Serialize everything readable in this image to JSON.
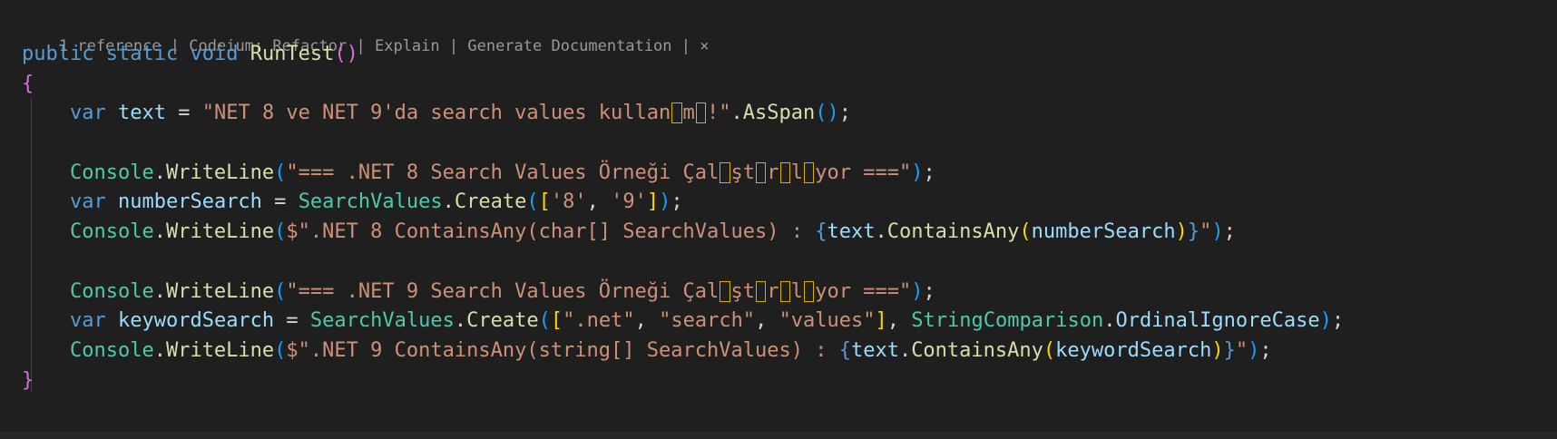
{
  "codelens": {
    "references": "1 reference",
    "codeium_refactor": "Codeium: Refactor",
    "explain": "Explain",
    "generate_docs": "Generate Documentation",
    "separator": " | ",
    "close": "×"
  },
  "lines": [
    [
      {
        "t": "public",
        "c": "kw"
      },
      {
        "t": " ",
        "c": "pu"
      },
      {
        "t": "static",
        "c": "kw"
      },
      {
        "t": " ",
        "c": "pu"
      },
      {
        "t": "void",
        "c": "kw"
      },
      {
        "t": " ",
        "c": "pu"
      },
      {
        "t": "RunTest",
        "c": "fn"
      },
      {
        "t": "()",
        "c": "pk"
      }
    ],
    [
      {
        "t": "{",
        "c": "pk"
      }
    ],
    [
      {
        "t": "    ",
        "c": "pu"
      },
      {
        "t": "var",
        "c": "kw"
      },
      {
        "t": " ",
        "c": "pu"
      },
      {
        "t": "text",
        "c": "id"
      },
      {
        "t": " = ",
        "c": "pu"
      },
      {
        "t": "\"NET 8 ve NET 9'da search values kullan",
        "c": "str"
      },
      {
        "t": "ı",
        "c": "ch"
      },
      {
        "t": "m",
        "c": "str"
      },
      {
        "t": "ı",
        "c": "ch"
      },
      {
        "t": "!\"",
        "c": "str"
      },
      {
        "t": ".",
        "c": "pu"
      },
      {
        "t": "AsSpan",
        "c": "fn"
      },
      {
        "t": "()",
        "c": "bb"
      },
      {
        "t": ";",
        "c": "pu"
      }
    ],
    [],
    [
      {
        "t": "    ",
        "c": "pu"
      },
      {
        "t": "Console",
        "c": "ty"
      },
      {
        "t": ".",
        "c": "pu"
      },
      {
        "t": "WriteLine",
        "c": "fn"
      },
      {
        "t": "(",
        "c": "bb"
      },
      {
        "t": "\"=== .NET 8 Search Values Örneği Çal",
        "c": "str"
      },
      {
        "t": "ı",
        "c": "ch"
      },
      {
        "t": "şt",
        "c": "str"
      },
      {
        "t": "ı",
        "c": "ch"
      },
      {
        "t": "r",
        "c": "str"
      },
      {
        "t": "ı",
        "c": "ch"
      },
      {
        "t": "l",
        "c": "str"
      },
      {
        "t": "ı",
        "c": "ch"
      },
      {
        "t": "yor ===\"",
        "c": "str"
      },
      {
        "t": ")",
        "c": "bb"
      },
      {
        "t": ";",
        "c": "pu"
      }
    ],
    [
      {
        "t": "    ",
        "c": "pu"
      },
      {
        "t": "var",
        "c": "kw"
      },
      {
        "t": " ",
        "c": "pu"
      },
      {
        "t": "numberSearch",
        "c": "id"
      },
      {
        "t": " = ",
        "c": "pu"
      },
      {
        "t": "SearchValues",
        "c": "ty"
      },
      {
        "t": ".",
        "c": "pu"
      },
      {
        "t": "Create",
        "c": "fn"
      },
      {
        "t": "(",
        "c": "bb"
      },
      {
        "t": "[",
        "c": "br"
      },
      {
        "t": "'8'",
        "c": "str"
      },
      {
        "t": ", ",
        "c": "pu"
      },
      {
        "t": "'9'",
        "c": "str"
      },
      {
        "t": "]",
        "c": "br"
      },
      {
        "t": ")",
        "c": "bb"
      },
      {
        "t": ";",
        "c": "pu"
      }
    ],
    [
      {
        "t": "    ",
        "c": "pu"
      },
      {
        "t": "Console",
        "c": "ty"
      },
      {
        "t": ".",
        "c": "pu"
      },
      {
        "t": "WriteLine",
        "c": "fn"
      },
      {
        "t": "(",
        "c": "bb"
      },
      {
        "t": "$\".NET 8 ContainsAny(char[] SearchValues) : ",
        "c": "str"
      },
      {
        "t": "{",
        "c": "kw"
      },
      {
        "t": "text",
        "c": "id"
      },
      {
        "t": ".",
        "c": "pu"
      },
      {
        "t": "ContainsAny",
        "c": "fn"
      },
      {
        "t": "(",
        "c": "br"
      },
      {
        "t": "numberSearch",
        "c": "id"
      },
      {
        "t": ")",
        "c": "br"
      },
      {
        "t": "}",
        "c": "kw"
      },
      {
        "t": "\"",
        "c": "str"
      },
      {
        "t": ")",
        "c": "bb"
      },
      {
        "t": ";",
        "c": "pu"
      }
    ],
    [],
    [
      {
        "t": "    ",
        "c": "pu"
      },
      {
        "t": "Console",
        "c": "ty"
      },
      {
        "t": ".",
        "c": "pu"
      },
      {
        "t": "WriteLine",
        "c": "fn"
      },
      {
        "t": "(",
        "c": "bb"
      },
      {
        "t": "\"=== .NET 9 Search Values Örneği Çal",
        "c": "str"
      },
      {
        "t": "ı",
        "c": "ch"
      },
      {
        "t": "şt",
        "c": "str"
      },
      {
        "t": "ı",
        "c": "ch"
      },
      {
        "t": "r",
        "c": "str"
      },
      {
        "t": "ı",
        "c": "ch"
      },
      {
        "t": "l",
        "c": "str"
      },
      {
        "t": "ı",
        "c": "ch"
      },
      {
        "t": "yor ===\"",
        "c": "str"
      },
      {
        "t": ")",
        "c": "bb"
      },
      {
        "t": ";",
        "c": "pu"
      }
    ],
    [
      {
        "t": "    ",
        "c": "pu"
      },
      {
        "t": "var",
        "c": "kw"
      },
      {
        "t": " ",
        "c": "pu"
      },
      {
        "t": "keywordSearch",
        "c": "id"
      },
      {
        "t": " = ",
        "c": "pu"
      },
      {
        "t": "SearchValues",
        "c": "ty"
      },
      {
        "t": ".",
        "c": "pu"
      },
      {
        "t": "Create",
        "c": "fn"
      },
      {
        "t": "(",
        "c": "bb"
      },
      {
        "t": "[",
        "c": "br"
      },
      {
        "t": "\".net\"",
        "c": "str"
      },
      {
        "t": ", ",
        "c": "pu"
      },
      {
        "t": "\"search\"",
        "c": "str"
      },
      {
        "t": ", ",
        "c": "pu"
      },
      {
        "t": "\"values\"",
        "c": "str"
      },
      {
        "t": "]",
        "c": "br"
      },
      {
        "t": ", ",
        "c": "pu"
      },
      {
        "t": "StringComparison",
        "c": "ty"
      },
      {
        "t": ".",
        "c": "pu"
      },
      {
        "t": "OrdinalIgnoreCase",
        "c": "id"
      },
      {
        "t": ")",
        "c": "bb"
      },
      {
        "t": ";",
        "c": "pu"
      }
    ],
    [
      {
        "t": "    ",
        "c": "pu"
      },
      {
        "t": "Console",
        "c": "ty"
      },
      {
        "t": ".",
        "c": "pu"
      },
      {
        "t": "WriteLine",
        "c": "fn"
      },
      {
        "t": "(",
        "c": "bb"
      },
      {
        "t": "$\".NET 9 ContainsAny(string[] SearchValues) : ",
        "c": "str"
      },
      {
        "t": "{",
        "c": "kw"
      },
      {
        "t": "text",
        "c": "id"
      },
      {
        "t": ".",
        "c": "pu"
      },
      {
        "t": "ContainsAny",
        "c": "fn"
      },
      {
        "t": "(",
        "c": "br"
      },
      {
        "t": "keywordSearch",
        "c": "id"
      },
      {
        "t": ")",
        "c": "br"
      },
      {
        "t": "}",
        "c": "kw"
      },
      {
        "t": "\"",
        "c": "str"
      },
      {
        "t": ")",
        "c": "bb"
      },
      {
        "t": ";",
        "c": "pu"
      }
    ],
    [
      {
        "t": "}",
        "c": "pk"
      }
    ]
  ]
}
